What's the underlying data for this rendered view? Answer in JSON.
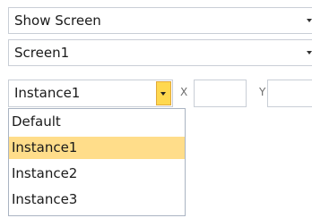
{
  "action_combo": {
    "value": "Show Screen"
  },
  "screen_combo": {
    "value": "Screen1"
  },
  "instance_combo": {
    "value": "Instance1",
    "options": [
      "Default",
      "Instance1",
      "Instance2",
      "Instance3"
    ],
    "highlighted_option": "Instance1"
  },
  "coords": {
    "x_label": "X",
    "x_value": "",
    "y_label": "Y",
    "y_value": ""
  },
  "icons": {
    "dropdown": "chevron-down-icon"
  },
  "colors": {
    "highlight": "#ffdd8a",
    "dropdown_button": "#ffd84f",
    "border": "#c9ced6"
  }
}
